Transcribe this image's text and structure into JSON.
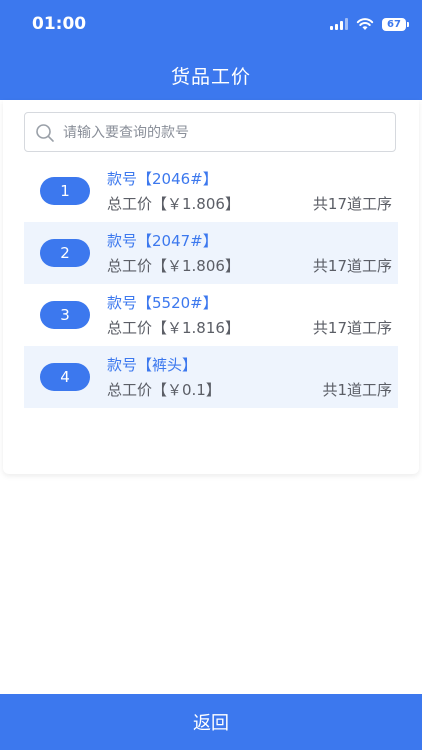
{
  "status": {
    "time": "01:00",
    "battery": "67"
  },
  "header": {
    "title": "货品工价"
  },
  "search": {
    "placeholder": "请输入要查询的款号"
  },
  "items": [
    {
      "index": "1",
      "code": "款号【2046#】",
      "price": "总工价【￥1.806】",
      "steps": "共17道工序"
    },
    {
      "index": "2",
      "code": "款号【2047#】",
      "price": "总工价【￥1.806】",
      "steps": "共17道工序"
    },
    {
      "index": "3",
      "code": "款号【5520#】",
      "price": "总工价【￥1.816】",
      "steps": "共17道工序"
    },
    {
      "index": "4",
      "code": "款号【裤头】",
      "price": "总工价【￥0.1】",
      "steps": "共1道工序"
    }
  ],
  "footer": {
    "back_label": "返回"
  },
  "colors": {
    "accent": "#3c78ee",
    "row_alt": "#eef4fd"
  }
}
